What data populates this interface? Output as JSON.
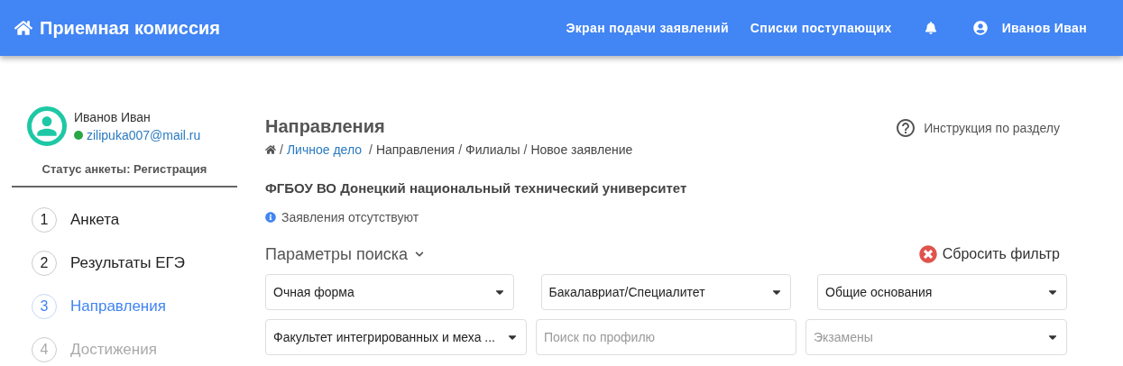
{
  "header": {
    "title": "Приемная комиссия",
    "nav": [
      "Экран подачи заявлений",
      "Списки поступающих"
    ],
    "user": "Иванов Иван"
  },
  "profile": {
    "name": "Иванов Иван",
    "email": "zilipuka007@mail.ru",
    "online": true,
    "status": "Статус анкеты: Регистрация"
  },
  "steps": [
    {
      "number": "1",
      "label": "Анкета",
      "selected": false,
      "disabled": false
    },
    {
      "number": "2",
      "label": "Результаты ЕГЭ",
      "selected": false,
      "disabled": false
    },
    {
      "number": "3",
      "label": "Направления",
      "selected": true,
      "disabled": false
    },
    {
      "number": "4",
      "label": "Достижения",
      "selected": false,
      "disabled": true
    }
  ],
  "page": {
    "title": "Направления",
    "separator": "/",
    "help": "Инструкция по разделу",
    "breadcrumbs": [
      {
        "label": "Личное дело",
        "link": true
      },
      {
        "label": "Направления",
        "link": false
      },
      {
        "label": "Филиалы",
        "link": false
      },
      {
        "label": "Новое заявление",
        "link": false
      }
    ],
    "university": "ФГБОУ ВО Донецкий национальный технический университет",
    "notice": "Заявления отсутствуют"
  },
  "search": {
    "title": "Параметры поиска",
    "expanded": true,
    "reset": "Сбросить фильтр",
    "rows": [
      [
        {
          "kind": "select",
          "value": "Очная форма"
        },
        {
          "kind": "select",
          "value": "Бакалавриат/Специалитет"
        },
        {
          "kind": "select",
          "value": "Общие основания"
        }
      ],
      [
        {
          "kind": "select",
          "value": "Факультет интегрированных и меха ..."
        },
        {
          "kind": "input",
          "placeholder": "Поиск по профилю"
        },
        {
          "kind": "select",
          "placeholder": "Экзамены"
        }
      ]
    ]
  }
}
